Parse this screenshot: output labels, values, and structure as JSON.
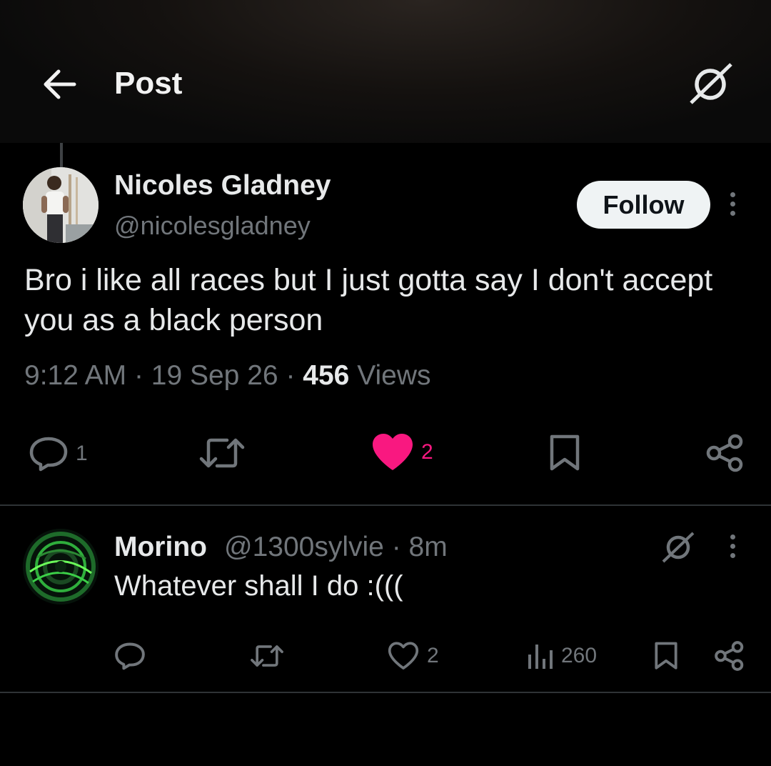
{
  "header": {
    "title": "Post",
    "back_icon": "arrow-left-icon",
    "grok_icon": "grok-icon"
  },
  "tweet": {
    "author_name": "Nicoles Gladney",
    "author_handle": "@nicolesgladney",
    "follow_label": "Follow",
    "text": "Bro i like all races but I just gotta say I don't accept you as a black person",
    "time": "9:12 AM",
    "date": "19 Sep 26",
    "views_count": "456",
    "views_label": "Views",
    "actions": {
      "reply_count": "1",
      "repost_count": "",
      "like_count": "2",
      "liked": true
    }
  },
  "reply": {
    "author_name": "Morino",
    "author_handle": "@1300sylvie",
    "age": "8m",
    "text": "Whatever shall I do :(((",
    "actions": {
      "reply_count": "",
      "repost_count": "",
      "like_count": "2",
      "views_count": "260"
    }
  },
  "colors": {
    "background": "#000000",
    "text": "#e7e9ea",
    "muted": "#71767b",
    "like_pink": "#f91880",
    "follow_bg": "#eff3f4",
    "divider": "#2f3336"
  }
}
